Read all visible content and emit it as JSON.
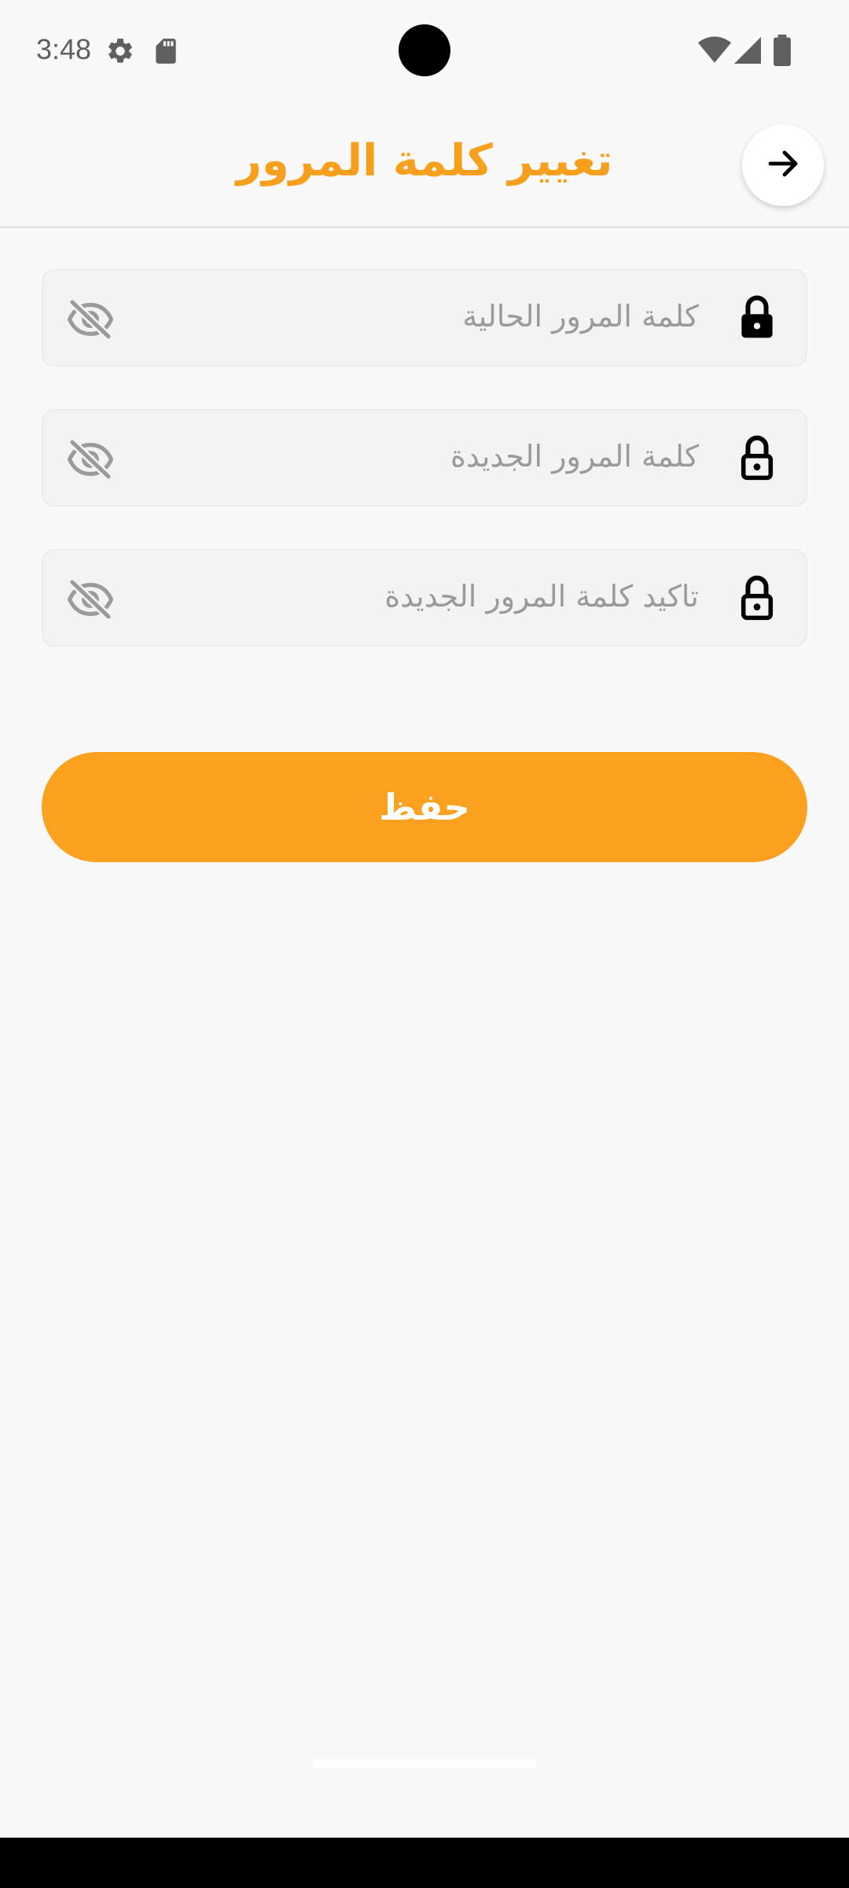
{
  "status_bar": {
    "time": "3:48",
    "icons": [
      "settings-icon",
      "sd-card-icon",
      "wifi-icon",
      "signal-icon",
      "battery-icon"
    ]
  },
  "app_bar": {
    "title": "تغيير كلمة المرور",
    "back_icon": "arrow-right-icon"
  },
  "form": {
    "fields": [
      {
        "placeholder": "كلمة المرور الحالية",
        "lock_icon": "lock-filled-icon",
        "toggle_icon": "eye-off-icon"
      },
      {
        "placeholder": "كلمة المرور الجديدة",
        "lock_icon": "lock-outline-icon",
        "toggle_icon": "eye-off-icon"
      },
      {
        "placeholder": "تاكيد كلمة المرور الجديدة",
        "lock_icon": "lock-outline-icon",
        "toggle_icon": "eye-off-icon"
      }
    ],
    "save_label": "حفظ"
  },
  "colors": {
    "accent": "#f7a01e",
    "button": "#fca01f",
    "background": "#f9f9f9",
    "field_background": "#f3f3f3",
    "placeholder": "#9a9a9a"
  }
}
